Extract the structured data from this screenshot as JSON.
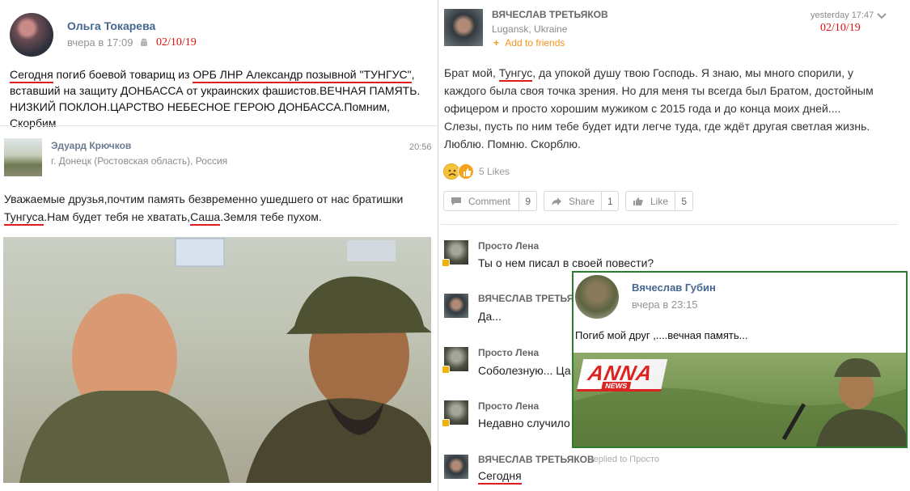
{
  "post1": {
    "author": "Ольга Токарева",
    "time": "вчера в 17:09",
    "date_mark": "02/10/19",
    "text_parts": {
      "a": "Сегодня",
      "b": " погиб боевой товарищ из ",
      "c": "ОРБ ЛНР Александр позывной \"ТУНГУС\"",
      "d": ",",
      "line2": "вставший на защиту ДОНБАССА от украинских фашистов.ВЕЧНАЯ ПАМЯТЬ.",
      "line3": "НИЗКИЙ ПОКЛОН.ЦАРСТВО НЕБЕСНОЕ ГЕРОЮ ДОНБАССА.Помним, Скорбим"
    }
  },
  "post2": {
    "author": "Эдуард Крючков",
    "location": "г. Донецк (Ростовская область), Россия",
    "time": "20:56",
    "line1": "Уважаемые  друзья,почтим память безвременно ушедшего от нас братишки",
    "tungus": "Тунгуса",
    "mid": ".Нам будет тебя не хватать,",
    "sasha": "Саша",
    "end": ".Земля тебе пухом."
  },
  "post3": {
    "author": "ВЯЧЕСЛАВ ТРЕТЬЯКОВ",
    "location": "Lugansk, Ukraine",
    "add_friends": "Add to friends",
    "time": "yesterday 17:47",
    "date_mark": "02/10/19",
    "line1a": "Брат мой, ",
    "line1b": "Тунгус",
    "line1c": ", да упокой душу твою Господь. Я знаю, мы много спорили, у",
    "line2": "каждого была своя точка зрения. Но для меня ты всегда был Братом, достойным",
    "line3": "офицером и просто хорошим мужиком с 2015 года и до конца моих дней....",
    "line4": "Слезы, пусть по ним тебе будет идти легче туда, где ждёт другая светлая жизнь.",
    "line5": "Люблю. Помню. Скорблю.",
    "likes": "5 Likes",
    "comment_label": "Comment",
    "comment_count": "9",
    "share_label": "Share",
    "share_count": "1",
    "like_label": "Like",
    "like_count": "5"
  },
  "comments": [
    {
      "name": "Просто Лена",
      "text": "Ты о нем писал в своей повести?"
    },
    {
      "name": "ВЯЧЕСЛАВ ТРЕТЬЯКОВ",
      "text": "Да..."
    },
    {
      "name": "Просто Лена",
      "text": "Соболезную... Ца"
    },
    {
      "name": "Просто Лена",
      "text": "Недавно случило"
    },
    {
      "name": "ВЯЧЕСЛАВ ТРЕТЬЯКОВ",
      "replied": "replied to Просто",
      "text": "Сегодня"
    }
  ],
  "overlay": {
    "author": "Вячеслав Губин",
    "time": "вчера в 23:15",
    "text": "Погиб мой друг ,....вечная память...",
    "logo": "ANNA",
    "logo_sub": "NEWS"
  },
  "colors": {
    "link": "#45678f",
    "red": "#d11",
    "green_frame": "#2e7d2e",
    "ok_orange": "#f7931e"
  }
}
